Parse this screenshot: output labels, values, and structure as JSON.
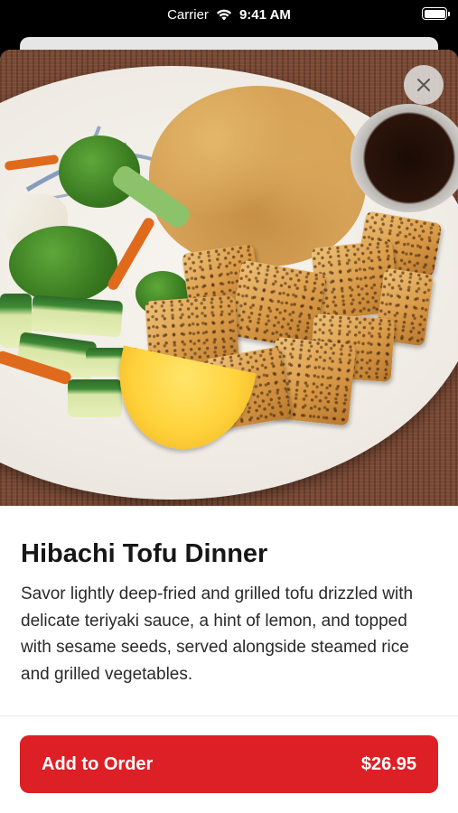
{
  "status_bar": {
    "carrier": "Carrier",
    "time": "9:41 AM",
    "wifi_icon": "wifi-icon",
    "battery_icon": "battery-icon"
  },
  "item": {
    "image_alt": "food-photo",
    "name": "Hibachi Tofu Dinner",
    "description": "Savor lightly deep-fried and grilled tofu drizzled with delicate teriyaki sauce, a hint of lemon, and topped with sesame seeds, served alongside steamed rice and grilled vegetables."
  },
  "close": {
    "icon": "close-icon"
  },
  "order_button": {
    "label": "Add to Order",
    "price": "$26.95"
  },
  "colors": {
    "accent": "#dd1f26",
    "text": "#161616"
  }
}
